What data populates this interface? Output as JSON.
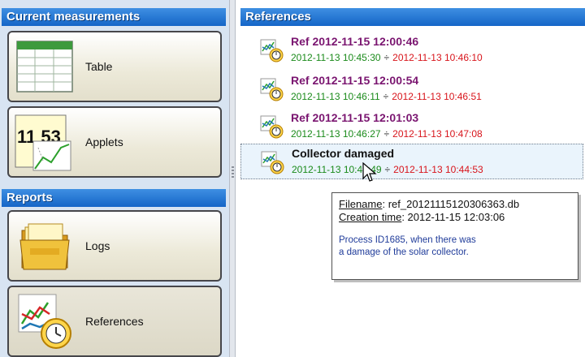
{
  "left_panel": {
    "current_header": "Current measurements",
    "reports_header": "Reports",
    "buttons": [
      {
        "label": "Table",
        "icon": "table-icon"
      },
      {
        "label": "Applets",
        "icon": "applet-icon",
        "display_digits": "11 53"
      },
      {
        "label": "Logs",
        "icon": "logs-folder-icon"
      },
      {
        "label": "References",
        "icon": "references-icon",
        "selected": true
      }
    ]
  },
  "right_panel": {
    "header": "References",
    "items": [
      {
        "title": "Ref 2012-11-15 12:00:46",
        "start": "2012-11-13 10:45:30",
        "sep": "÷",
        "end": "2012-11-13 10:46:10"
      },
      {
        "title": "Ref 2012-11-15 12:00:54",
        "start": "2012-11-13 10:46:11",
        "sep": "÷",
        "end": "2012-11-13 10:46:51"
      },
      {
        "title": "Ref 2012-11-15 12:01:03",
        "start": "2012-11-13 10:46:27",
        "sep": "÷",
        "end": "2012-11-13 10:47:08"
      },
      {
        "title": "Collector damaged",
        "start": "2012-11-13 10:43:49",
        "sep": "÷",
        "end": "2012-11-13 10:44:53",
        "highlighted": true
      }
    ]
  },
  "tooltip": {
    "filename_label": "Filename",
    "filename_value": ": ref_20121115120306363.db",
    "creation_label": "Creation time",
    "creation_value": ": 2012-11-15 12:03:06",
    "description_line1": "Process ID1685, when there was",
    "description_line2": "a damage of the solar collector."
  },
  "colors": {
    "header_blue": "#1565c7",
    "title_purple": "#7a1570",
    "start_green": "#1a8a1a",
    "end_red": "#d8141b",
    "panel_bg": "#d8e4f2"
  }
}
